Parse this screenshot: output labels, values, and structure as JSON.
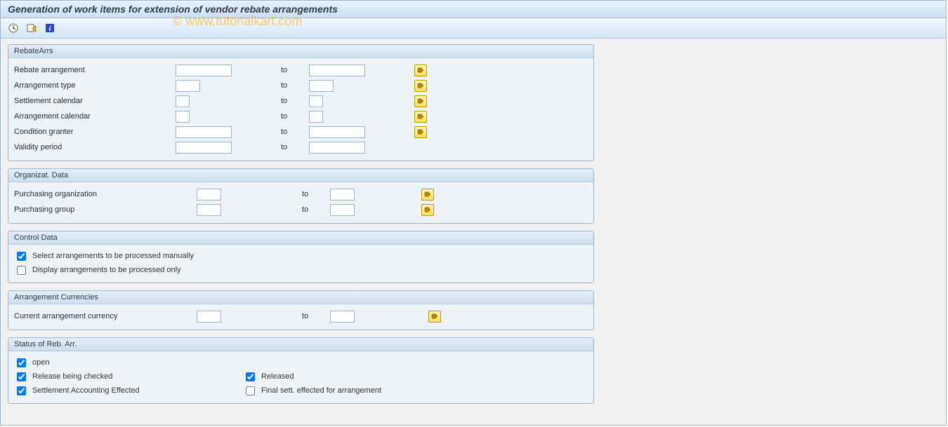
{
  "window": {
    "title": "Generation of work items for extension of vendor rebate arrangements"
  },
  "watermark": "© www.tutorialkart.com",
  "toolbar": {
    "execute": "execute-icon",
    "variant": "variant-icon",
    "info": "info-icon"
  },
  "panels": {
    "rebate": {
      "title": "RebateArrs",
      "to_label": "to",
      "rows": {
        "arrangement": "Rebate arrangement",
        "type": "Arrangement type",
        "settle_cal": "Settlement calendar",
        "arr_cal": "Arrangement calendar",
        "granter": "Condition granter",
        "validity": "Validity period"
      }
    },
    "org": {
      "title": "Organizat. Data",
      "to_label": "to",
      "rows": {
        "purch_org": "Purchasing organization",
        "purch_grp": "Purchasing group"
      }
    },
    "control": {
      "title": "Control Data",
      "opts": {
        "select_manual": "Select arrangements to be processed manually",
        "display_only": "Display arrangements to be processed only"
      }
    },
    "currency": {
      "title": "Arrangement Currencies",
      "to_label": "to",
      "row": "Current arrangement currency"
    },
    "status": {
      "title": "Status of Reb. Arr.",
      "opts": {
        "open": "open",
        "release_check": "Release being checked",
        "released": "Released",
        "settle_eff": "Settlement Accounting Effected",
        "final_sett": "Final sett. effected for arrangement"
      }
    }
  }
}
